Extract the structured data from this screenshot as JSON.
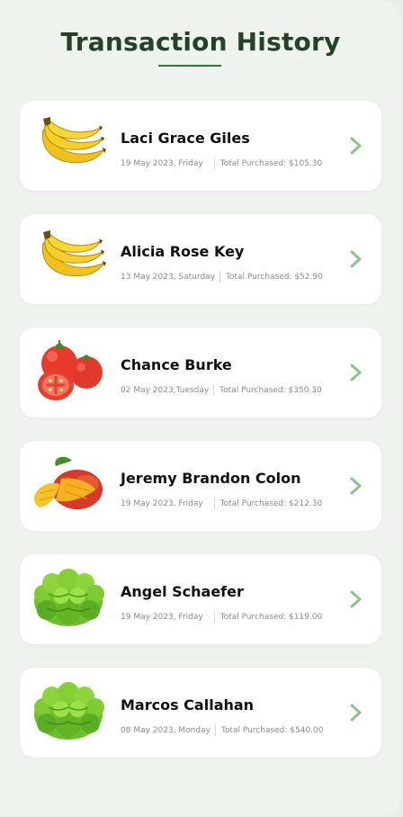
{
  "header": {
    "title": "Transaction History"
  },
  "transactions": [
    {
      "name": "Laci Grace Giles",
      "date": "19 May 2023, Friday",
      "total": "Total Purchased: $105.30",
      "icon": "banana-icon"
    },
    {
      "name": "Alicia Rose Key",
      "date": "13 May 2023, Saturday",
      "total": "Total Purchased: $52.90",
      "icon": "banana-icon"
    },
    {
      "name": "Chance Burke",
      "date": "02 May 2023,Tuesday",
      "total": "Total Purchased: $350.30",
      "icon": "tomato-icon"
    },
    {
      "name": "Jeremy Brandon Colon",
      "date": "19 May 2023, Friday",
      "total": "Total Purchased: $212.30",
      "icon": "mango-icon"
    },
    {
      "name": "Angel Schaefer",
      "date": "19 May 2023, Friday",
      "total": "Total Purchased: $119.00",
      "icon": "lettuce-icon"
    },
    {
      "name": "Marcos Callahan",
      "date": "08 May 2023, Monday",
      "total": "Total Purchased: $540.00",
      "icon": "lettuce-icon"
    }
  ],
  "colors": {
    "background": "#eef3ed",
    "title": "#23422a",
    "accent": "#8fc18f",
    "card": "#ffffff"
  }
}
